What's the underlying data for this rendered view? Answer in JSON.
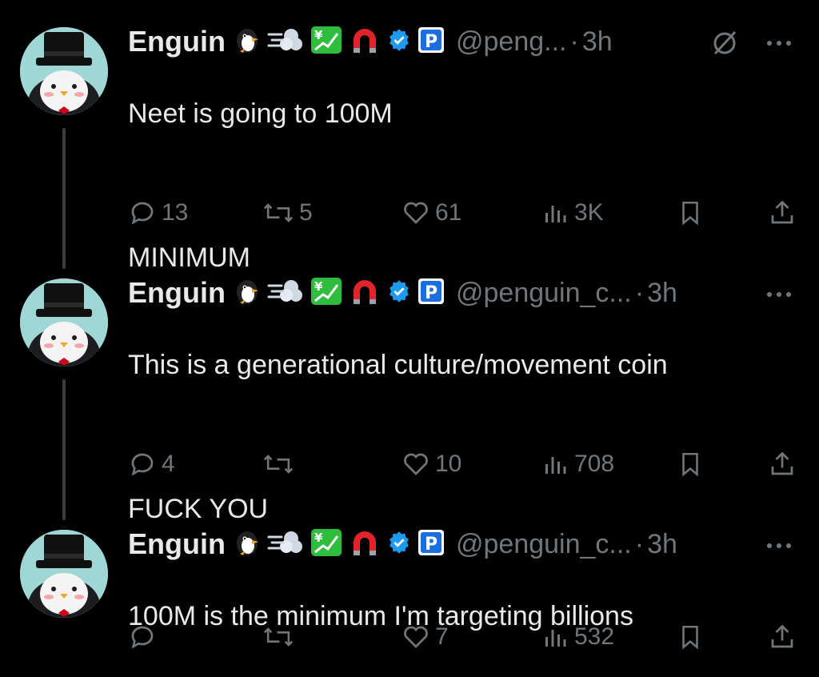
{
  "tweets": [
    {
      "name": "Enguin",
      "handle": "@peng...",
      "time": "3h",
      "text_lines": [
        "Neet is going to 100M",
        "",
        "MINIMUM"
      ],
      "replies": "13",
      "retweets": "5",
      "likes": "61",
      "views": "3K",
      "show_grok": true
    },
    {
      "name": "Enguin",
      "handle": "@penguin_c...",
      "time": "3h",
      "text_lines": [
        "This is a generational culture/movement coin",
        "",
        "FUCK YOU"
      ],
      "replies": "4",
      "retweets": "",
      "likes": "10",
      "views": "708",
      "show_grok": false
    },
    {
      "name": "Enguin",
      "handle": "@penguin_c...",
      "time": "3h",
      "text_lines": [
        "100M is the minimum I'm targeting billions"
      ],
      "replies": "",
      "retweets": "",
      "likes": "7",
      "views": "532",
      "show_grok": false
    }
  ],
  "separator": "·",
  "colors": {
    "bg": "#000000",
    "text": "#e7e9ea",
    "muted": "#71767b",
    "verified": "#1d9bf0"
  },
  "icons": [
    "penguin-emoji-icon",
    "dash-emoji-icon",
    "chart-yen-emoji-icon",
    "magnet-emoji-icon",
    "verified-badge-icon",
    "parking-emoji-icon",
    "grok-icon",
    "more-icon",
    "reply-icon",
    "retweet-icon",
    "like-icon",
    "views-icon",
    "bookmark-icon",
    "share-icon"
  ]
}
